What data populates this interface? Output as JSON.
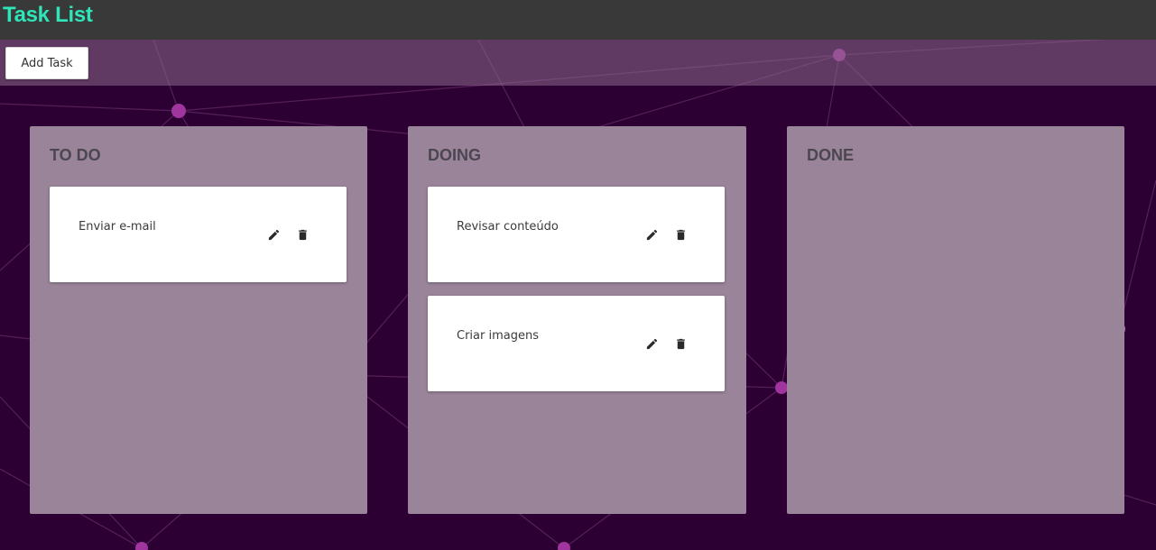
{
  "header": {
    "title": "Task List",
    "title_color": "#2ee6b8"
  },
  "toolbar": {
    "add_label": "Add Task"
  },
  "columns": [
    {
      "title": "TO DO",
      "tasks": [
        {
          "text": "Enviar e-mail"
        }
      ]
    },
    {
      "title": "DOING",
      "tasks": [
        {
          "text": "Revisar conteúdo"
        },
        {
          "text": "Criar imagens"
        }
      ]
    },
    {
      "title": "DONE",
      "tasks": []
    }
  ],
  "icons": {
    "edit": "pencil-icon",
    "delete": "trash-icon"
  },
  "colors": {
    "background": "#2d0033",
    "column": "#9a8499",
    "header": "#393939",
    "node": "#a0359f"
  }
}
